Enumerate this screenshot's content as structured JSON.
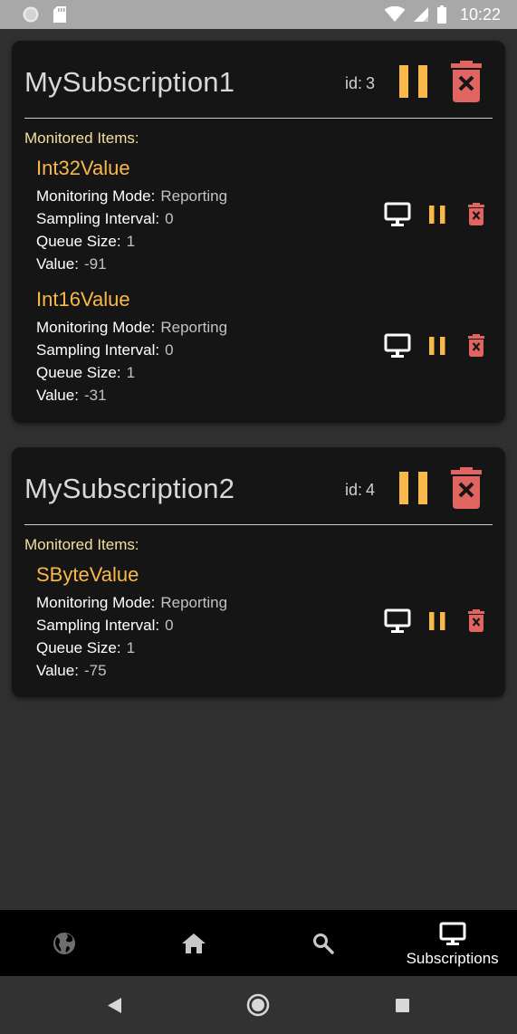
{
  "status_bar": {
    "time": "10:22",
    "icons": [
      "circle-notification-icon",
      "sd-card-icon",
      "wifi-icon",
      "signal-icon",
      "battery-icon"
    ]
  },
  "colors": {
    "accent_orange": "#f8b94a",
    "delete_red": "#e0645f",
    "label_yellow": "#f7dfa0",
    "card_bg": "#151515",
    "page_bg": "#303030"
  },
  "subscriptions": [
    {
      "title": "MySubscription1",
      "id_label": "id:",
      "id": "3",
      "monitored_label": "Monitored Items:",
      "items": [
        {
          "name": "Int32Value",
          "mode_label": "Monitoring Mode:",
          "mode": "Reporting",
          "interval_label": "Sampling Interval:",
          "interval": "0",
          "queue_label": "Queue Size:",
          "queue": "1",
          "value_label": "Value:",
          "value": "-91"
        },
        {
          "name": "Int16Value",
          "mode_label": "Monitoring Mode:",
          "mode": "Reporting",
          "interval_label": "Sampling Interval:",
          "interval": "0",
          "queue_label": "Queue Size:",
          "queue": "1",
          "value_label": "Value:",
          "value": "-31"
        }
      ]
    },
    {
      "title": "MySubscription2",
      "id_label": "id:",
      "id": "4",
      "monitored_label": "Monitored Items:",
      "items": [
        {
          "name": "SByteValue",
          "mode_label": "Monitoring Mode:",
          "mode": "Reporting",
          "interval_label": "Sampling Interval:",
          "interval": "0",
          "queue_label": "Queue Size:",
          "queue": "1",
          "value_label": "Value:",
          "value": "-75"
        }
      ]
    }
  ],
  "bottom_nav": {
    "items": [
      {
        "icon": "globe-icon",
        "label": ""
      },
      {
        "icon": "home-icon",
        "label": ""
      },
      {
        "icon": "search-icon",
        "label": ""
      },
      {
        "icon": "monitor-icon",
        "label": "Subscriptions",
        "active": true
      }
    ]
  },
  "system_nav": {
    "icons": [
      "back-icon",
      "home-circle-icon",
      "recents-icon"
    ]
  }
}
